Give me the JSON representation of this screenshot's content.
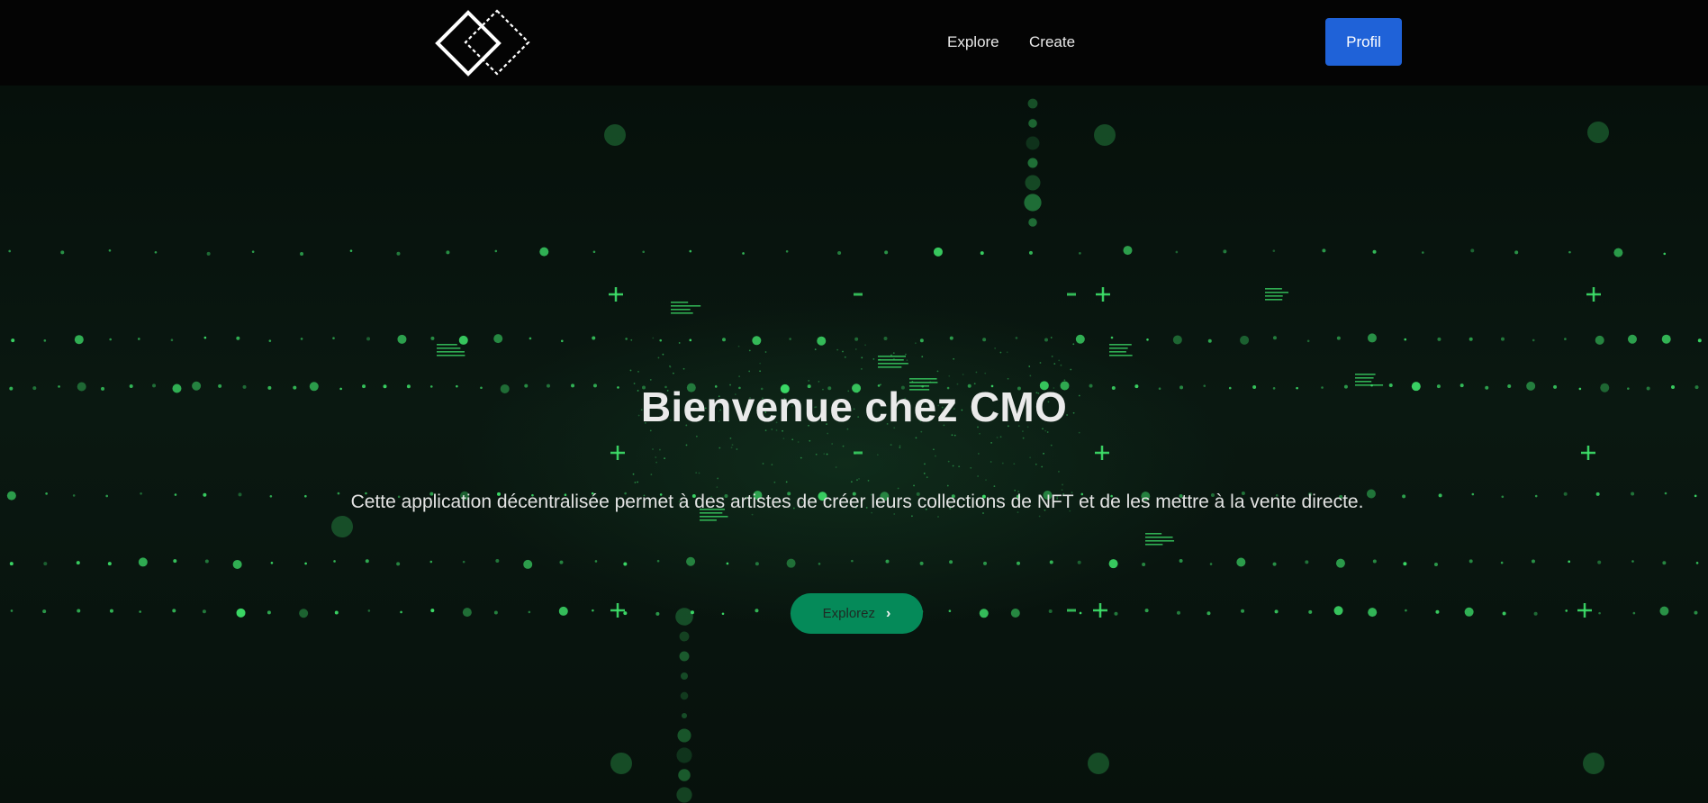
{
  "navbar": {
    "logo_icon": "double-diamond-logo-icon",
    "links": [
      {
        "label": "Explore"
      },
      {
        "label": "Create"
      }
    ],
    "profile_button": "Profil"
  },
  "hero": {
    "title": "Bienvenue chez CMO",
    "description": "Cette application décentralisée permet à des artistes de créer leurs collections de NFT et de les mettre à la vente directe.",
    "cta_label": "Explorez",
    "cta_icon": "chevron-right-icon"
  },
  "colors": {
    "navbar_bg": "#040404",
    "primary_button": "#1f62d8",
    "cta_button": "#058a59",
    "accent_green": "#3ee26a"
  }
}
